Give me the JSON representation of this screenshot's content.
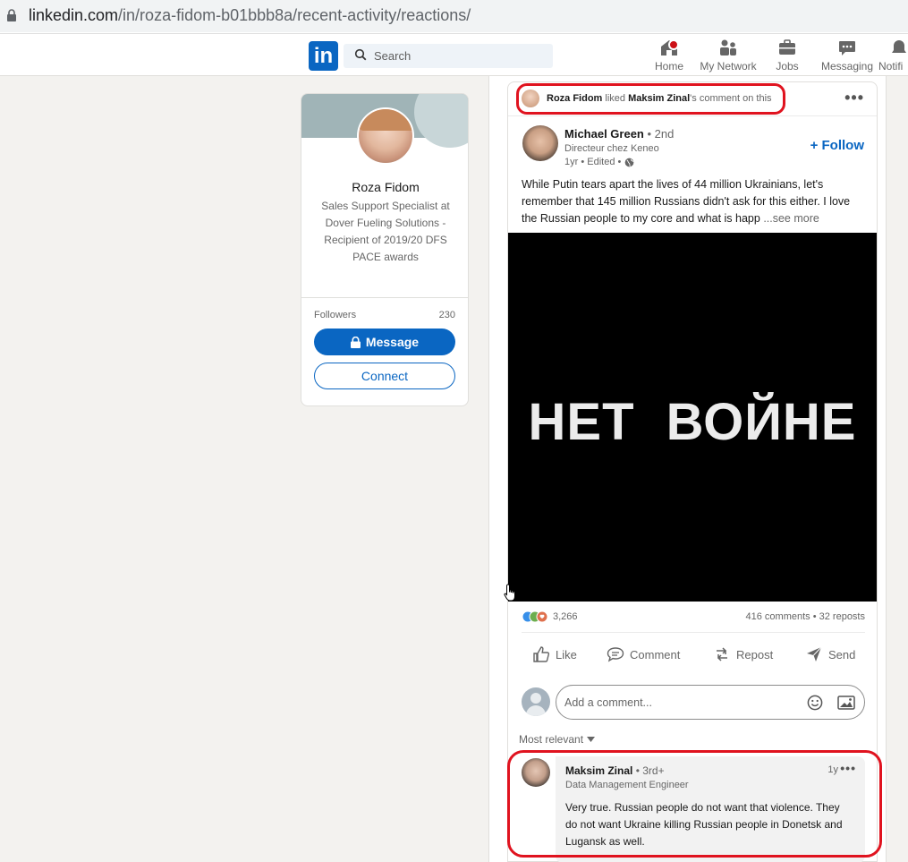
{
  "browser": {
    "url_domain": "linkedin.com",
    "url_path": "/in/roza-fidom-b01bbb8a/recent-activity/reactions/"
  },
  "nav": {
    "logo": "in",
    "search_placeholder": "Search",
    "items": [
      {
        "label": "Home",
        "icon": "home-icon"
      },
      {
        "label": "My Network",
        "icon": "people-icon"
      },
      {
        "label": "Jobs",
        "icon": "briefcase-icon"
      },
      {
        "label": "Messaging",
        "icon": "chat-icon"
      },
      {
        "label": "Notifi",
        "icon": "bell-icon"
      }
    ]
  },
  "profile": {
    "name": "Roza Fidom",
    "headline": "Sales Support Specialist at Dover Fueling Solutions - Recipient of 2019/20 DFS PACE awards",
    "followers_label": "Followers",
    "followers_count": "230",
    "message_label": "Message",
    "connect_label": "Connect"
  },
  "activity": {
    "actor": "Roza Fidom",
    "verb": "liked",
    "target": "Maksim Zinal",
    "suffix": "'s comment on this"
  },
  "post": {
    "author_name": "Michael Green",
    "author_degree": "• 2nd",
    "author_title": "Directeur chez Keneo",
    "meta": "1yr • Edited •",
    "follow_label": "+ Follow",
    "text": "While Putin tears apart the lives of 44 million Ukrainians, let's remember that 145 million Russians didn't ask for this either. I love the Russian people to my core and what is happ",
    "see_more": "...see more",
    "image_text": "НЕТ ВОЙНЕ",
    "reactions_count": "3,266",
    "comments_reposts": "416 comments • 32 reposts",
    "actions": [
      "Like",
      "Comment",
      "Repost",
      "Send"
    ],
    "comment_placeholder": "Add a comment...",
    "sort_label": "Most relevant"
  },
  "comment": {
    "name": "Maksim Zinal",
    "degree": "• 3rd+",
    "title": "Data Management Engineer",
    "time": "1y",
    "text": "Very true. Russian people do not want that violence. They do not want Ukraine killing Russian people in Donetsk and Lugansk as well."
  },
  "colors": {
    "brand": "#0a66c2",
    "highlight": "#e0131f",
    "background": "#f3f2ef"
  }
}
